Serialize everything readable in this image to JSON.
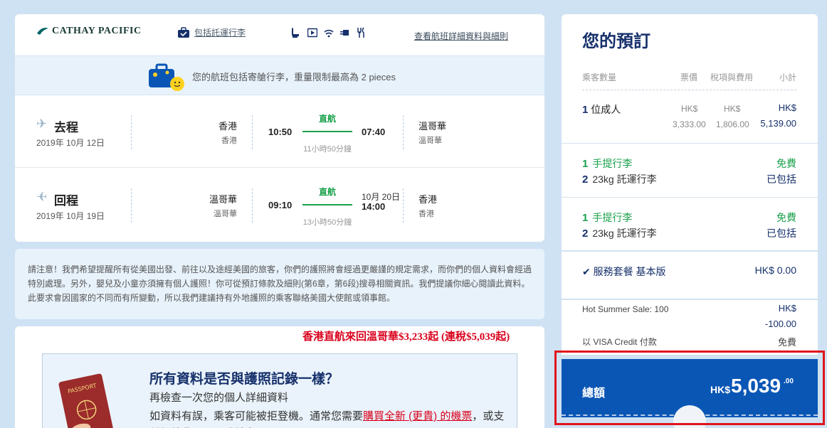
{
  "header": {
    "brand": "CATHAY PACIFIC",
    "baggage_link": "包括託運行李",
    "details_link": "查看航班詳細資料與細則"
  },
  "banner": {
    "text": "您的航班包括寄艙行李，重量限制最高為 2 pieces"
  },
  "outbound": {
    "label": "去程",
    "date": "2019年 10月 12日",
    "from_city": "香港",
    "from_sub": "香港",
    "dep": "10:50",
    "arr": "07:40",
    "nonstop": "直航",
    "duration": "11小時50分鐘",
    "to_city": "溫哥華",
    "to_sub": "溫哥華"
  },
  "inbound": {
    "label": "回程",
    "date": "2019年 10月 19日",
    "from_city": "溫哥華",
    "from_sub": "溫哥華",
    "dep": "09:10",
    "arr_date": "10月 20日",
    "arr": "14:00",
    "nonstop": "直航",
    "duration": "13小時50分鐘",
    "to_city": "香港",
    "to_sub": "香港"
  },
  "notice": "請注意！我們希望提醒所有從美國出發、前往以及途經美國的旅客，你們的護照將會經過更嚴謹的規定需求，而你們的個人資料會經過特別處理。另外，嬰兒及小童亦須擁有個人護照！你可從預訂條款及細則(第6章，第6段)搜尋相關資訊。我們提議你細心閱讀此資料。此要求會因國家的不同而有所變動，所以我們建議持有外地護照的乘客聯絡美國大使館或領事館。",
  "promo": "香港直航來回溫哥華$3,233起 (連稅$5,039起)",
  "passport": {
    "title": "所有資料是否與護照記錄一樣？",
    "subtitle": "再檢查一次您的個人詳細資料",
    "body_pre": "如資料有誤，乘客可能被拒登機。通常您需要",
    "body_link": "購買全新 (更貴) 的機票",
    "body_post": "，或支付額外費用以更改姓名。",
    "ill_label": "PASSPORT"
  },
  "booking": {
    "title": "您的預訂",
    "headers": {
      "pax": "乘客數量",
      "fare": "票價",
      "tax": "稅項與費用",
      "subtotal": "小計"
    },
    "pax_count": "1",
    "pax_label": "位成人",
    "currency": "HK$",
    "fare": "3,333.00",
    "tax": "1,806.00",
    "subtotal": "5,139.00",
    "bags": [
      {
        "cabin_n": "1",
        "cabin": "手提行李",
        "cabin_status": "免費",
        "check_n": "2",
        "check": "23kg 託運行李",
        "check_status": "已包括"
      },
      {
        "cabin_n": "1",
        "cabin": "手提行李",
        "cabin_status": "免費",
        "check_n": "2",
        "check": "23kg 託運行李",
        "check_status": "已包括"
      }
    ],
    "service": {
      "label": "服務套餐 基本版",
      "price": "HK$ 0.00"
    },
    "discount": {
      "label": "Hot Summer Sale: 100",
      "cur": "HK$",
      "amount": "-100.00"
    },
    "payment": {
      "label": "以 VISA Credit 付款",
      "fee": "免費"
    },
    "total": {
      "label": "總額",
      "cur": "HK$",
      "amount": "5,039",
      "decimals": ".00"
    }
  },
  "colors": {
    "brand_blue": "#0a56b5",
    "green": "#19a14b",
    "highlight": "#e0141e"
  }
}
